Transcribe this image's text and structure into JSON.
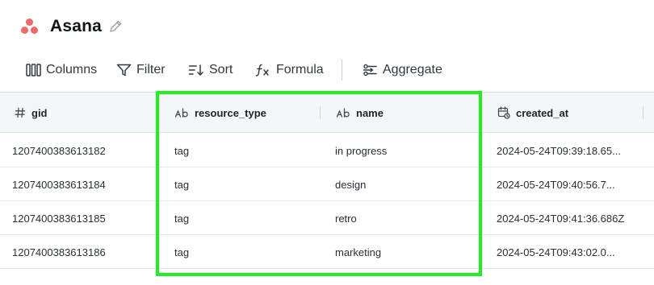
{
  "app": {
    "title": "Asana",
    "logo_colors": [
      "#f06a6a",
      "#f06a6a",
      "#f06a6a"
    ]
  },
  "toolbar": {
    "columns_label": "Columns",
    "filter_label": "Filter",
    "sort_label": "Sort",
    "formula_label": "Formula",
    "aggregate_label": "Aggregate"
  },
  "table": {
    "columns": [
      {
        "label": "gid",
        "icon": "hash-icon"
      },
      {
        "label": "resource_type",
        "icon": "text-type-icon"
      },
      {
        "label": "name",
        "icon": "text-type-icon"
      },
      {
        "label": "created_at",
        "icon": "calendar-clock-icon"
      }
    ],
    "rows": [
      {
        "gid": "1207400383613182",
        "resource_type": "tag",
        "name": "in progress",
        "created_at": "2024-05-24T09:39:18.65..."
      },
      {
        "gid": "1207400383613184",
        "resource_type": "tag",
        "name": "design",
        "created_at": "2024-05-24T09:40:56.7..."
      },
      {
        "gid": "1207400383613185",
        "resource_type": "tag",
        "name": "retro",
        "created_at": "2024-05-24T09:41:36.686Z"
      },
      {
        "gid": "1207400383613186",
        "resource_type": "tag",
        "name": "marketing",
        "created_at": "2024-05-24T09:43:02.0..."
      }
    ]
  },
  "highlight_color": "#22ee22"
}
